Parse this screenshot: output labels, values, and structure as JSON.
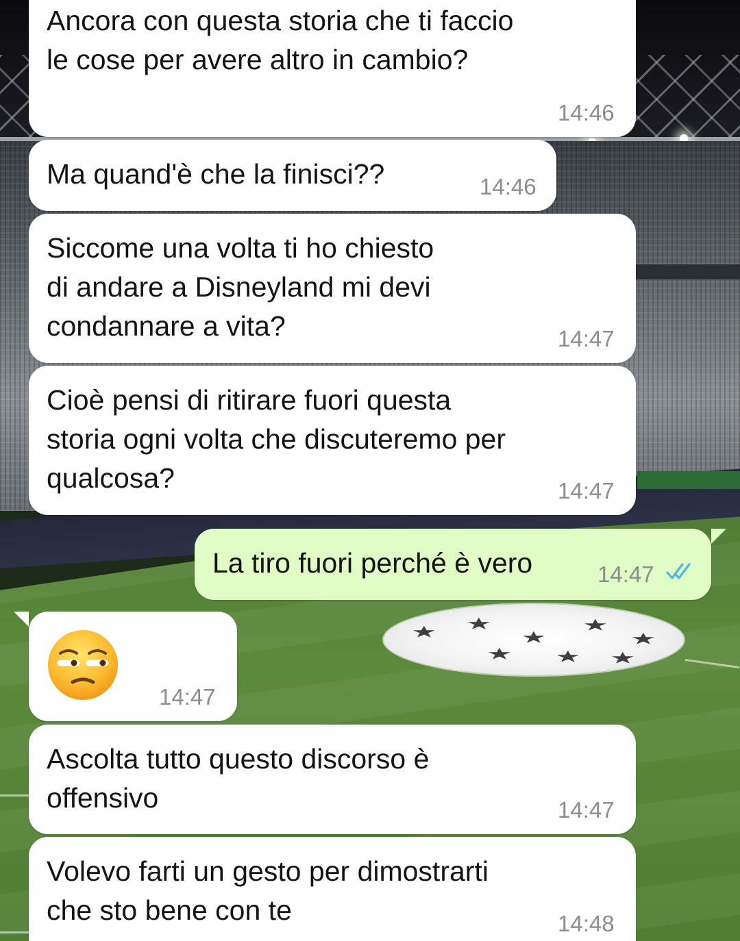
{
  "messages": [
    {
      "direction": "in",
      "text": "Ancora con questa storia che ti faccio\nle cose per avere altro in cambio?",
      "time": "14:46"
    },
    {
      "direction": "in",
      "text": "Ma quand'è che la finisci??",
      "time": "14:46"
    },
    {
      "direction": "in",
      "text": "Siccome una volta ti ho chiesto\ndi andare a Disneyland mi devi\ncondannare a vita?",
      "time": "14:47"
    },
    {
      "direction": "in",
      "text": "Cioè pensi di ritirare fuori questa\nstoria ogni volta che discuteremo per\nqualcosa?",
      "time": "14:47"
    },
    {
      "direction": "out",
      "text": "La tiro fuori perché è vero",
      "time": "14:47",
      "status": "read",
      "status_icon": "double-check-icon",
      "status_color": "#4fb6ec"
    },
    {
      "direction": "in",
      "emoji": "unamused-face-emoji",
      "time": "14:47"
    },
    {
      "direction": "in",
      "text": "Ascolta tutto questo discorso è\noffensivo",
      "time": "14:47"
    },
    {
      "direction": "in",
      "text": "Volevo farti un gesto per dimostrarti\nche sto bene con te",
      "time": "14:48"
    }
  ],
  "colors": {
    "incoming_bubble": "#ffffff",
    "outgoing_bubble": "#e1fbc7",
    "timestamp": "#8d8d8d",
    "read_ticks": "#4fb6ec"
  },
  "wallpaper": "stadium-pitch-wallpaper"
}
